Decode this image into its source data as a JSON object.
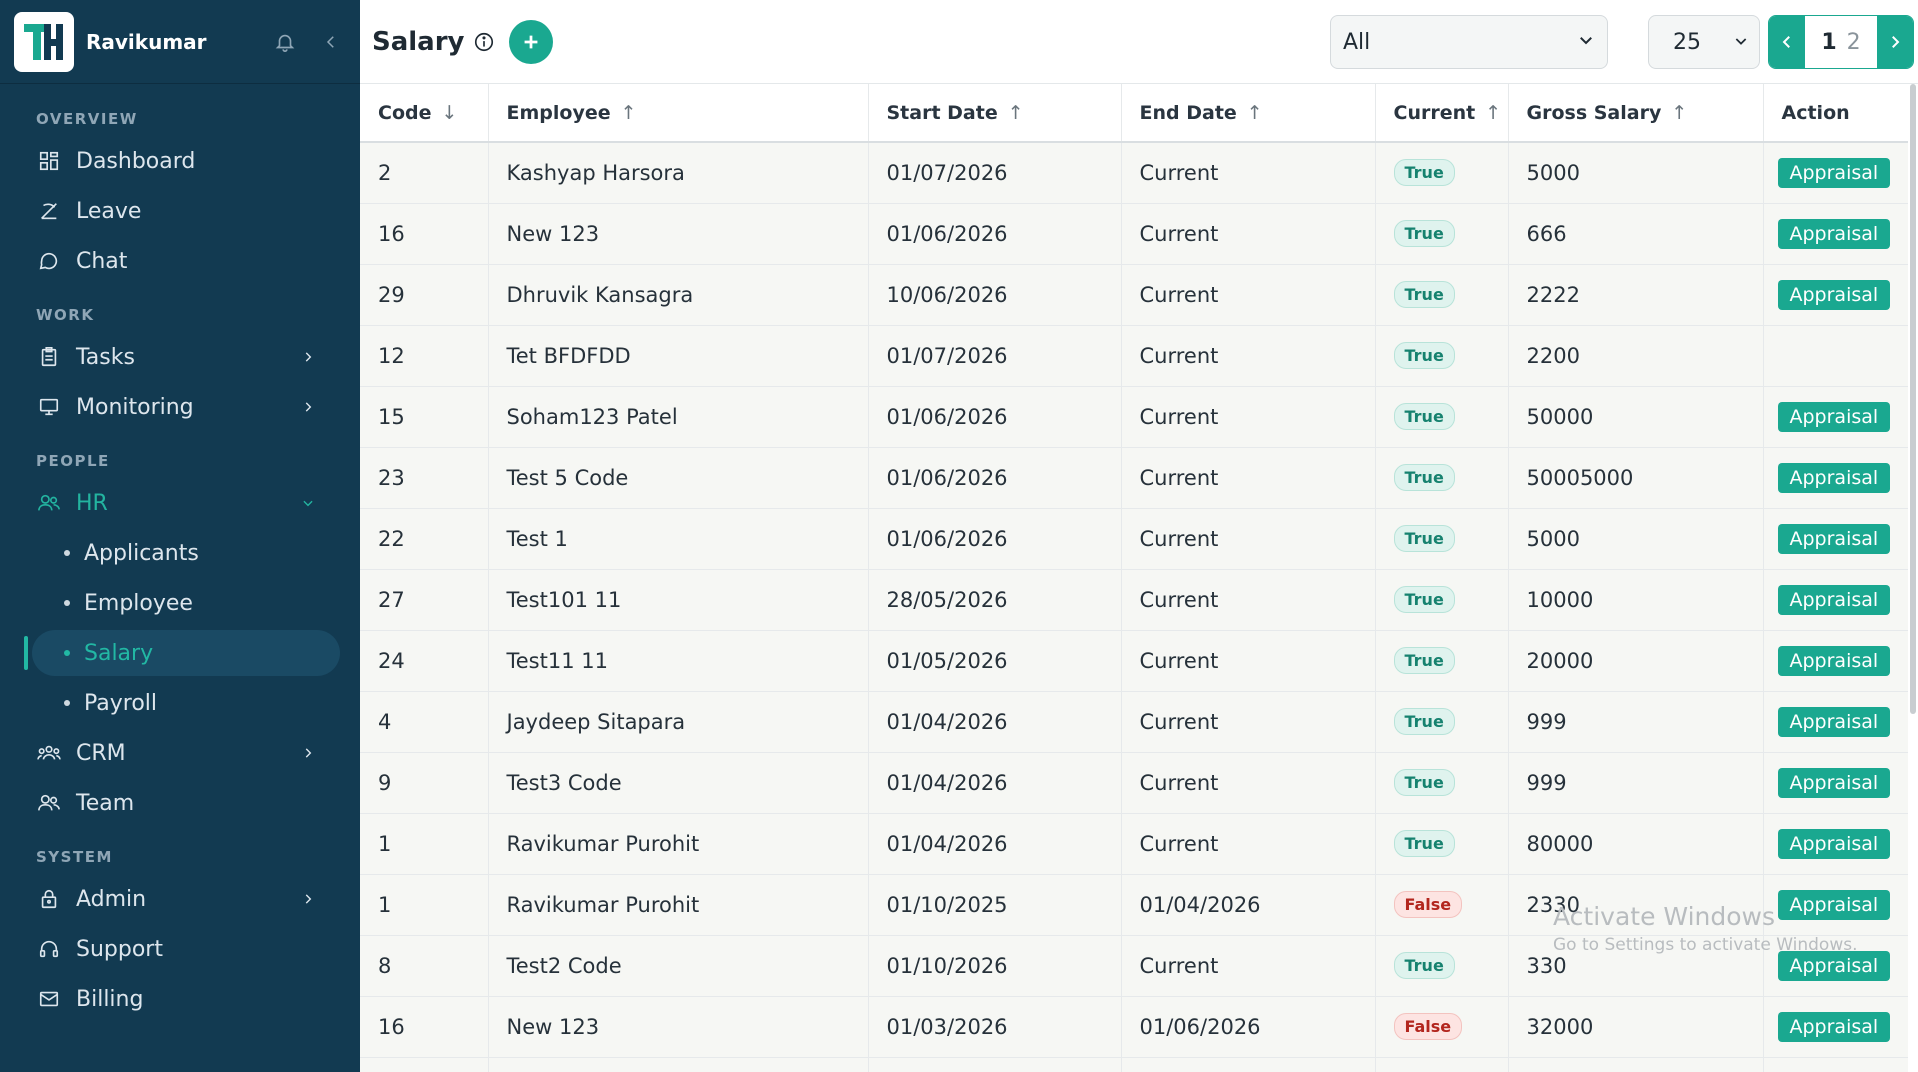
{
  "user": {
    "name": "Ravikumar"
  },
  "sidebar": {
    "sections": {
      "overview": "OVERVIEW",
      "work": "WORK",
      "people": "PEOPLE",
      "system": "SYSTEM"
    },
    "items": {
      "dashboard": "Dashboard",
      "leave": "Leave",
      "chat": "Chat",
      "tasks": "Tasks",
      "monitoring": "Monitoring",
      "hr": "HR",
      "applicants": "Applicants",
      "employee": "Employee",
      "salary": "Salary",
      "payroll": "Payroll",
      "crm": "CRM",
      "team": "Team",
      "admin": "Admin",
      "support": "Support",
      "billing": "Billing"
    }
  },
  "header": {
    "title": "Salary",
    "filter_value": "All",
    "page_size": "25",
    "current_page": "1",
    "other_page": "2"
  },
  "table": {
    "columns": {
      "code": "Code",
      "employee": "Employee",
      "start_date": "Start Date",
      "end_date": "End Date",
      "current": "Current",
      "gross_salary": "Gross Salary",
      "action": "Action"
    },
    "rows": [
      {
        "code": "2",
        "employee": "Kashyap Harsora",
        "start_date": "01/07/2026",
        "end_date": "Current",
        "current": "True",
        "gross": "5000",
        "action": "Appraisal"
      },
      {
        "code": "16",
        "employee": "New 123",
        "start_date": "01/06/2026",
        "end_date": "Current",
        "current": "True",
        "gross": "666",
        "action": "Appraisal"
      },
      {
        "code": "29",
        "employee": "Dhruvik Kansagra",
        "start_date": "10/06/2026",
        "end_date": "Current",
        "current": "True",
        "gross": "2222",
        "action": "Appraisal"
      },
      {
        "code": "12",
        "employee": "Tet BFDFDD",
        "start_date": "01/07/2026",
        "end_date": "Current",
        "current": "True",
        "gross": "2200",
        "action": ""
      },
      {
        "code": "15",
        "employee": "Soham123 Patel",
        "start_date": "01/06/2026",
        "end_date": "Current",
        "current": "True",
        "gross": "50000",
        "action": "Appraisal"
      },
      {
        "code": "23",
        "employee": "Test 5 Code",
        "start_date": "01/06/2026",
        "end_date": "Current",
        "current": "True",
        "gross": "50005000",
        "action": "Appraisal"
      },
      {
        "code": "22",
        "employee": "Test 1",
        "start_date": "01/06/2026",
        "end_date": "Current",
        "current": "True",
        "gross": "5000",
        "action": "Appraisal"
      },
      {
        "code": "27",
        "employee": "Test101 11",
        "start_date": "28/05/2026",
        "end_date": "Current",
        "current": "True",
        "gross": "10000",
        "action": "Appraisal"
      },
      {
        "code": "24",
        "employee": "Test11 11",
        "start_date": "01/05/2026",
        "end_date": "Current",
        "current": "True",
        "gross": "20000",
        "action": "Appraisal"
      },
      {
        "code": "4",
        "employee": "Jaydeep Sitapara",
        "start_date": "01/04/2026",
        "end_date": "Current",
        "current": "True",
        "gross": "999",
        "action": "Appraisal"
      },
      {
        "code": "9",
        "employee": "Test3 Code",
        "start_date": "01/04/2026",
        "end_date": "Current",
        "current": "True",
        "gross": "999",
        "action": "Appraisal"
      },
      {
        "code": "1",
        "employee": "Ravikumar Purohit",
        "start_date": "01/04/2026",
        "end_date": "Current",
        "current": "True",
        "gross": "80000",
        "action": "Appraisal"
      },
      {
        "code": "1",
        "employee": "Ravikumar Purohit",
        "start_date": "01/10/2025",
        "end_date": "01/04/2026",
        "current": "False",
        "gross": "2330",
        "action": "Appraisal"
      },
      {
        "code": "8",
        "employee": "Test2 Code",
        "start_date": "01/10/2026",
        "end_date": "Current",
        "current": "True",
        "gross": "330",
        "action": "Appraisal"
      },
      {
        "code": "16",
        "employee": "New 123",
        "start_date": "01/03/2026",
        "end_date": "01/06/2026",
        "current": "False",
        "gross": "32000",
        "action": "Appraisal"
      },
      {
        "code": "",
        "employee": "",
        "start_date": "",
        "end_date": "",
        "current": "",
        "gross": "",
        "action": ""
      }
    ]
  },
  "watermark": {
    "line1": "Activate Windows",
    "line2": "Go to Settings to activate Windows."
  },
  "colors": {
    "sidebar_bg": "#123a51",
    "accent": "#1aa890",
    "true_badge": "#16826f",
    "false_badge": "#b3261e"
  }
}
